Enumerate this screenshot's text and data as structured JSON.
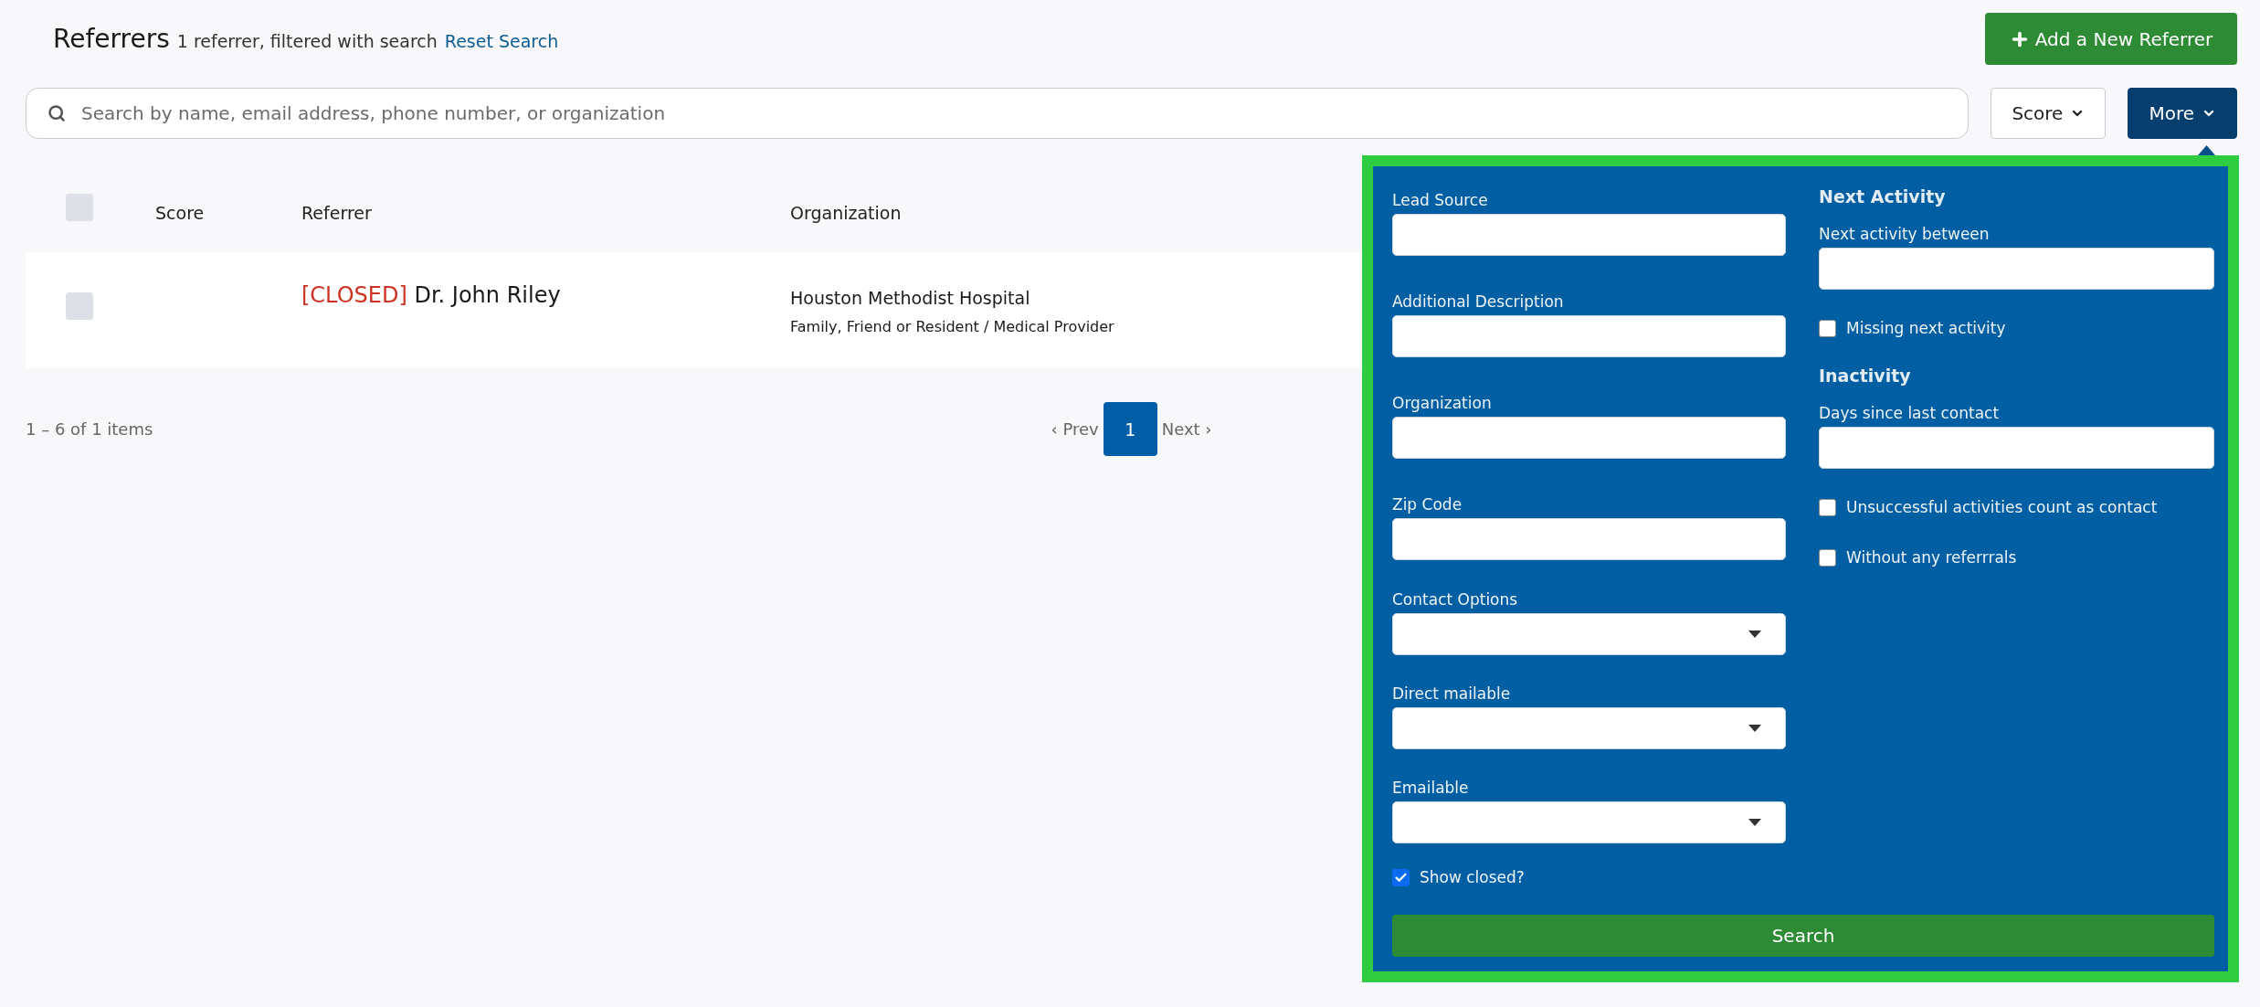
{
  "header": {
    "title": "Referrers",
    "summary": "1 referrer, filtered with search",
    "reset_link": "Reset Search",
    "add_button": "Add a New Referrer"
  },
  "search": {
    "placeholder": "Search by name, email address, phone number, or organization"
  },
  "filter_buttons": [
    {
      "label": "Score",
      "expanded": false
    },
    {
      "label": "More",
      "expanded": true
    }
  ],
  "table": {
    "header_checkbox": {
      "checked": false
    },
    "columns": [
      "Score",
      "Referrer",
      "Organization"
    ],
    "rows": [
      {
        "checked": false,
        "status": "[CLOSED]",
        "name": "Dr. John Riley",
        "organization": "Houston Methodist Hospital",
        "organization_type": "Family, Friend or Resident / Medical Provider"
      }
    ]
  },
  "pagination": {
    "summary": "1 – 6 of 1 items",
    "prev": "‹ Prev",
    "pages": [
      {
        "label": "1",
        "selected": true
      }
    ],
    "next": "Next ›"
  },
  "more_panel": {
    "left_fields": [
      {
        "kind": "text",
        "label": "Lead Source"
      },
      {
        "kind": "text",
        "label": "Additional Description"
      },
      {
        "kind": "text",
        "label": "Organization"
      },
      {
        "kind": "text",
        "label": "Zip Code"
      },
      {
        "kind": "select",
        "label": "Contact Options"
      },
      {
        "kind": "select",
        "label": "Direct mailable"
      },
      {
        "kind": "select",
        "label": "Emailable"
      },
      {
        "kind": "checkbox",
        "label": "Show closed?",
        "checked": true
      }
    ],
    "right_sections": [
      {
        "heading": "Next Activity",
        "fields": [
          {
            "kind": "text",
            "label": "Next activity between"
          },
          {
            "kind": "checkbox",
            "label": "Missing next activity",
            "checked": false
          }
        ]
      },
      {
        "heading": "Inactivity",
        "fields": [
          {
            "kind": "text",
            "label": "Days since last contact"
          },
          {
            "kind": "checkbox",
            "label": "Unsuccessful activities count as contact",
            "checked": false
          },
          {
            "kind": "checkbox",
            "label": "Without any referrrals",
            "checked": false
          }
        ]
      }
    ],
    "search_button": "Search"
  }
}
